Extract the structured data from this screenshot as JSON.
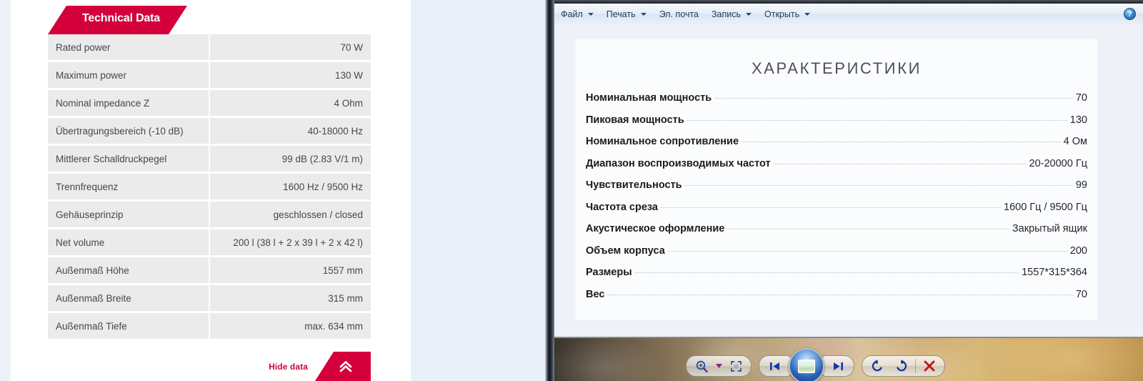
{
  "left_panel": {
    "banner_label": "Technical Data",
    "accent_color": "#d4003c",
    "rows": [
      {
        "name": "Rated power",
        "value": "70 W"
      },
      {
        "name": "Maximum power",
        "value": "130 W"
      },
      {
        "name": "Nominal impedance Z",
        "value": "4 Ohm"
      },
      {
        "name": "Übertragungsbereich (-10 dB)",
        "value": "40-18000 Hz"
      },
      {
        "name": "Mittlerer Schalldruckpegel",
        "value": "99 dB (2.83 V/1 m)"
      },
      {
        "name": "Trennfrequenz",
        "value": "1600 Hz / 9500 Hz"
      },
      {
        "name": "Gehäuseprinzip",
        "value": "geschlossen / closed"
      },
      {
        "name": "Net volume",
        "value": "200 l (38 l + 2 x 39 l + 2 x 42 l)"
      },
      {
        "name": "Außenmaß Höhe",
        "value": "1557 mm"
      },
      {
        "name": "Außenmaß Breite",
        "value": "315 mm"
      },
      {
        "name": "Außenmaß Tiefe",
        "value": "max. 634 mm"
      }
    ],
    "hide_data_label": "Hide data",
    "hide_data_icon": "double-chevron-up-icon"
  },
  "viewer": {
    "toolbar": {
      "menus": [
        {
          "label": "Файл",
          "has_caret": true
        },
        {
          "label": "Печать",
          "has_caret": true
        },
        {
          "label": "Эл. почта",
          "has_caret": false
        },
        {
          "label": "Запись",
          "has_caret": true
        },
        {
          "label": "Открыть",
          "has_caret": true
        }
      ],
      "help_label": "?"
    },
    "document": {
      "title": "ХАРАКТЕРИСТИКИ",
      "rows": [
        {
          "label": "Номинальная мощность",
          "value": "70"
        },
        {
          "label": "Пиковая мощность",
          "value": "130"
        },
        {
          "label": "Номинальное сопротивление",
          "value": "4 Ом"
        },
        {
          "label": "Диапазон воспроизводимых частот",
          "value": "20-20000 Гц"
        },
        {
          "label": "Чувствительность",
          "value": "99"
        },
        {
          "label": "Частота среза",
          "value": "1600 Гц / 9500 Гц"
        },
        {
          "label": "Акустическое оформление",
          "value": "Закрытый ящик"
        },
        {
          "label": "Объем корпуса",
          "value": "200"
        },
        {
          "label": "Размеры",
          "value": "1557*315*364"
        },
        {
          "label": "Вес",
          "value": "70"
        }
      ]
    },
    "controls": [
      {
        "name": "zoom-icon",
        "kind": "zoom"
      },
      {
        "name": "zoom-dropdown-caret-icon",
        "kind": "caret"
      },
      {
        "name": "actual-size-icon",
        "kind": "fit"
      },
      {
        "name": "previous-image-icon",
        "kind": "prev"
      },
      {
        "name": "play-slideshow-icon",
        "kind": "play"
      },
      {
        "name": "next-image-icon",
        "kind": "next"
      },
      {
        "name": "rotate-counterclockwise-icon",
        "kind": "rotate-ccw"
      },
      {
        "name": "rotate-clockwise-icon",
        "kind": "rotate-cw"
      },
      {
        "name": "delete-icon",
        "kind": "delete"
      }
    ]
  }
}
